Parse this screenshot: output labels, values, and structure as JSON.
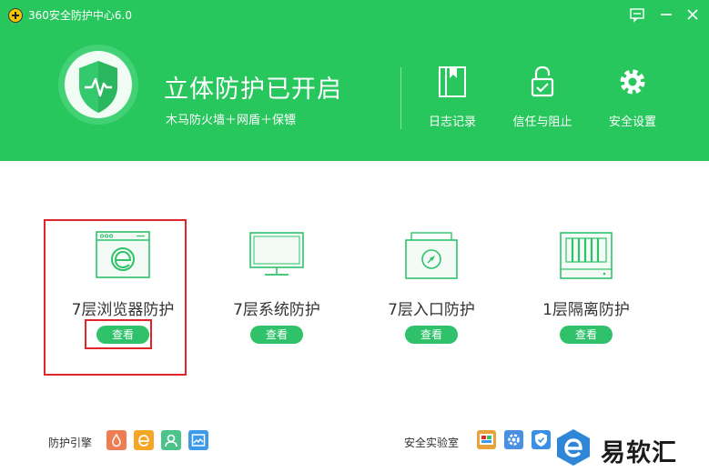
{
  "window": {
    "title": "360安全防护中心6.0",
    "controls": [
      "feedback-icon",
      "minimize-icon",
      "close-icon"
    ]
  },
  "status": {
    "title": "立体防护已开启",
    "subtitle": "木马防火墙＋网盾＋保镖"
  },
  "tools": [
    {
      "label": "日志记录",
      "icon": "log-book-icon"
    },
    {
      "label": "信任与阻止",
      "icon": "lock-icon"
    },
    {
      "label": "安全设置",
      "icon": "gear-icon"
    }
  ],
  "protections": [
    {
      "label": "7层浏览器防护",
      "button": "查看",
      "icon": "browser-icon",
      "highlighted": true
    },
    {
      "label": "7层系统防护",
      "button": "查看",
      "icon": "monitor-icon"
    },
    {
      "label": "7层入口防护",
      "button": "查看",
      "icon": "entry-icon"
    },
    {
      "label": "1层隔离防护",
      "button": "查看",
      "icon": "isolation-icon"
    }
  ],
  "engines": {
    "label": "防护引擎",
    "icons": [
      {
        "icon": "engine-1-icon",
        "color": "#f07d52"
      },
      {
        "icon": "engine-2-icon",
        "color": "#f5a623"
      },
      {
        "icon": "engine-3-icon",
        "color": "#4cc38a"
      },
      {
        "icon": "engine-4-icon",
        "color": "#3b9be8"
      }
    ]
  },
  "lab": {
    "label": "安全实验室",
    "icons": [
      {
        "icon": "lab-1-icon",
        "color": "#e8a23a"
      },
      {
        "icon": "lab-2-icon",
        "color": "#4a90e2"
      },
      {
        "icon": "lab-3-icon",
        "color": "#3b8fe6"
      }
    ]
  },
  "watermark": {
    "text": "易软汇"
  },
  "colors": {
    "header": "#28c75e",
    "button": "#2fc26a",
    "highlight": "#e0262a"
  }
}
